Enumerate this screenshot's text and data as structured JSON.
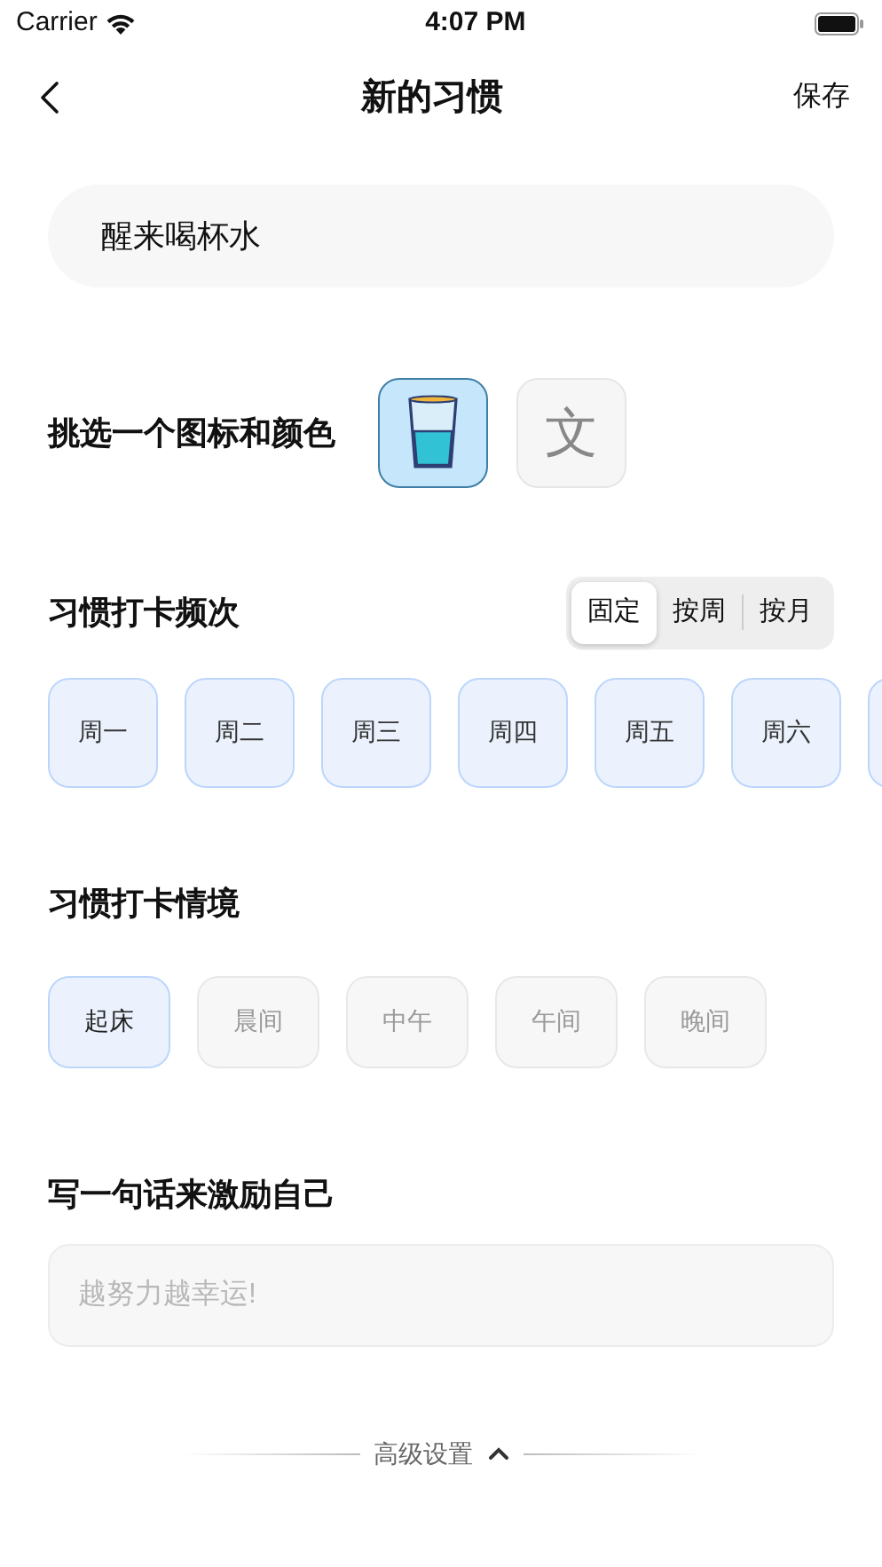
{
  "status_bar": {
    "carrier": "Carrier",
    "time": "4:07 PM"
  },
  "nav": {
    "title": "新的习惯",
    "action": "保存"
  },
  "habit_name": {
    "value": "醒来喝杯水"
  },
  "icon_picker": {
    "label": "挑选一个图标和颜色",
    "options": [
      {
        "kind": "glass",
        "selected": true
      },
      {
        "kind": "text",
        "label": "文",
        "selected": false
      }
    ]
  },
  "frequency": {
    "label": "习惯打卡频次",
    "segments": [
      {
        "label": "固定",
        "selected": true
      },
      {
        "label": "按周",
        "selected": false
      },
      {
        "label": "按月",
        "selected": false
      }
    ],
    "days": [
      {
        "label": "周一",
        "selected": true
      },
      {
        "label": "周二",
        "selected": true
      },
      {
        "label": "周三",
        "selected": true
      },
      {
        "label": "周四",
        "selected": true
      },
      {
        "label": "周五",
        "selected": true
      },
      {
        "label": "周六",
        "selected": true
      },
      {
        "selected": true
      }
    ]
  },
  "context": {
    "label": "习惯打卡情境",
    "options": [
      {
        "label": "起床",
        "selected": true
      },
      {
        "label": "晨间",
        "selected": false
      },
      {
        "label": "中午",
        "selected": false
      },
      {
        "label": "午间",
        "selected": false
      },
      {
        "label": "晚间",
        "selected": false
      }
    ]
  },
  "motto": {
    "label": "写一句话来激励自己",
    "placeholder": "越努力越幸运!"
  },
  "advanced": {
    "label": "高级设置",
    "expanded": true
  }
}
